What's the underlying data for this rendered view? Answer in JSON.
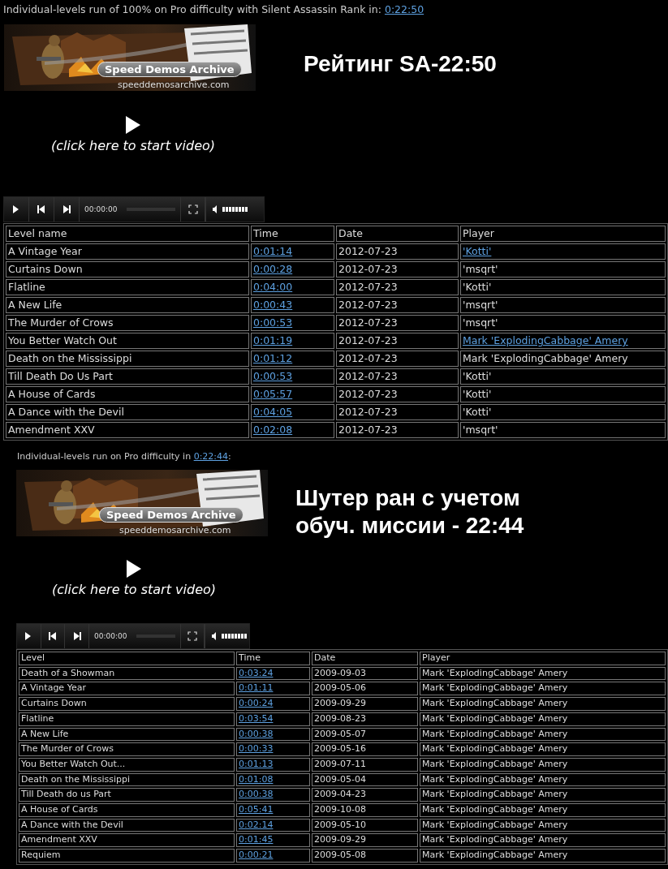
{
  "sections": [
    {
      "heading": {
        "text": "Individual-levels run of 100% on Pro difficulty with Silent Assassin Rank in: ",
        "link": "0:22:50"
      },
      "video": {
        "logo": "Speed Demos Archive",
        "url": "speeddemosarchive.com",
        "prompt": "(click here to start video)",
        "time": "00:00:00"
      },
      "annotation": [
        "Рейтинг SA-22:50"
      ],
      "table": {
        "columns": [
          "Level name",
          "Time",
          "Date",
          "Player"
        ],
        "rows": [
          {
            "level": "A Vintage Year",
            "time": "0:01:14",
            "date": "2012-07-23",
            "player": "'Kotti'",
            "player_link": true
          },
          {
            "level": "Curtains Down",
            "time": "0:00:28",
            "date": "2012-07-23",
            "player": "'msqrt'",
            "player_link": false
          },
          {
            "level": "Flatline",
            "time": "0:04:00",
            "date": "2012-07-23",
            "player": "'Kotti'",
            "player_link": false
          },
          {
            "level": "A New Life",
            "time": "0:00:43",
            "date": "2012-07-23",
            "player": "'msqrt'",
            "player_link": false
          },
          {
            "level": "The Murder of Crows",
            "time": "0:00:53",
            "date": "2012-07-23",
            "player": "'msqrt'",
            "player_link": false
          },
          {
            "level": "You Better Watch Out",
            "time": "0:01:19",
            "date": "2012-07-23",
            "player": "Mark 'ExplodingCabbage' Amery",
            "player_link": true
          },
          {
            "level": "Death on the Mississippi",
            "time": "0:01:12",
            "date": "2012-07-23",
            "player": "Mark 'ExplodingCabbage' Amery",
            "player_link": false
          },
          {
            "level": "Till Death Do Us Part",
            "time": "0:00:53",
            "date": "2012-07-23",
            "player": "'Kotti'",
            "player_link": false
          },
          {
            "level": "A House of Cards",
            "time": "0:05:57",
            "date": "2012-07-23",
            "player": "'Kotti'",
            "player_link": false
          },
          {
            "level": "A Dance with the Devil",
            "time": "0:04:05",
            "date": "2012-07-23",
            "player": "'Kotti'",
            "player_link": false
          },
          {
            "level": "Amendment XXV",
            "time": "0:02:08",
            "date": "2012-07-23",
            "player": "'msqrt'",
            "player_link": false
          }
        ]
      }
    },
    {
      "heading": {
        "text": "Individual-levels run on Pro difficulty in ",
        "link": "0:22:44",
        "after": ":"
      },
      "video": {
        "logo": "Speed Demos Archive",
        "url": "speeddemosarchive.com",
        "prompt": "(click here to start video)",
        "time": "00:00:00"
      },
      "annotation": [
        "Шутер ран с учетом",
        "обуч. миссии - 22:44"
      ],
      "table": {
        "columns": [
          "Level",
          "Time",
          "Date",
          "Player"
        ],
        "rows": [
          {
            "level": "Death of a Showman",
            "time": "0:03:24",
            "date": "2009-09-03",
            "player": "Mark 'ExplodingCabbage' Amery"
          },
          {
            "level": "A Vintage Year",
            "time": "0:01:11",
            "date": "2009-05-06",
            "player": "Mark 'ExplodingCabbage' Amery"
          },
          {
            "level": "Curtains Down",
            "time": "0:00:24",
            "date": "2009-09-29",
            "player": "Mark 'ExplodingCabbage' Amery"
          },
          {
            "level": "Flatline",
            "time": "0:03:54",
            "date": "2009-08-23",
            "player": "Mark 'ExplodingCabbage' Amery"
          },
          {
            "level": "A New Life",
            "time": "0:00:38",
            "date": "2009-05-07",
            "player": "Mark 'ExplodingCabbage' Amery"
          },
          {
            "level": "The Murder of Crows",
            "time": "0:00:33",
            "date": "2009-05-16",
            "player": "Mark 'ExplodingCabbage' Amery"
          },
          {
            "level": "You Better Watch Out...",
            "time": "0:01:13",
            "date": "2009-07-11",
            "player": "Mark 'ExplodingCabbage' Amery"
          },
          {
            "level": "Death on the Mississippi",
            "time": "0:01:08",
            "date": "2009-05-04",
            "player": "Mark 'ExplodingCabbage' Amery"
          },
          {
            "level": "Till Death do us Part",
            "time": "0:00:38",
            "date": "2009-04-23",
            "player": "Mark 'ExplodingCabbage' Amery"
          },
          {
            "level": "A House of Cards",
            "time": "0:05:41",
            "date": "2009-10-08",
            "player": "Mark 'ExplodingCabbage' Amery"
          },
          {
            "level": "A Dance with the Devil",
            "time": "0:02:14",
            "date": "2009-05-10",
            "player": "Mark 'ExplodingCabbage' Amery"
          },
          {
            "level": "Amendment XXV",
            "time": "0:01:45",
            "date": "2009-09-29",
            "player": "Mark 'ExplodingCabbage' Amery"
          },
          {
            "level": "Requiem",
            "time": "0:00:21",
            "date": "2009-05-08",
            "player": "Mark 'ExplodingCabbage' Amery"
          }
        ]
      }
    }
  ]
}
